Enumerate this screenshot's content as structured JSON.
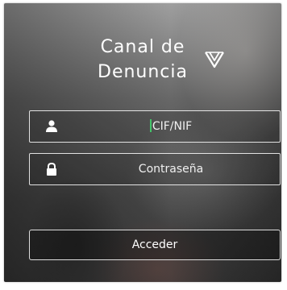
{
  "brand": {
    "title_line1": "Canal de",
    "title_line2": "Denuncia",
    "logo_icon": "v-shield-logo-icon"
  },
  "form": {
    "user": {
      "placeholder": "CIF/NIF",
      "icon": "user-icon",
      "focused": true
    },
    "password": {
      "placeholder": "Contraseña",
      "icon": "lock-icon"
    },
    "submit_label": "Acceder"
  },
  "colors": {
    "cursor": "#43c46a",
    "text": "#ffffff",
    "border": "#ffffff"
  }
}
